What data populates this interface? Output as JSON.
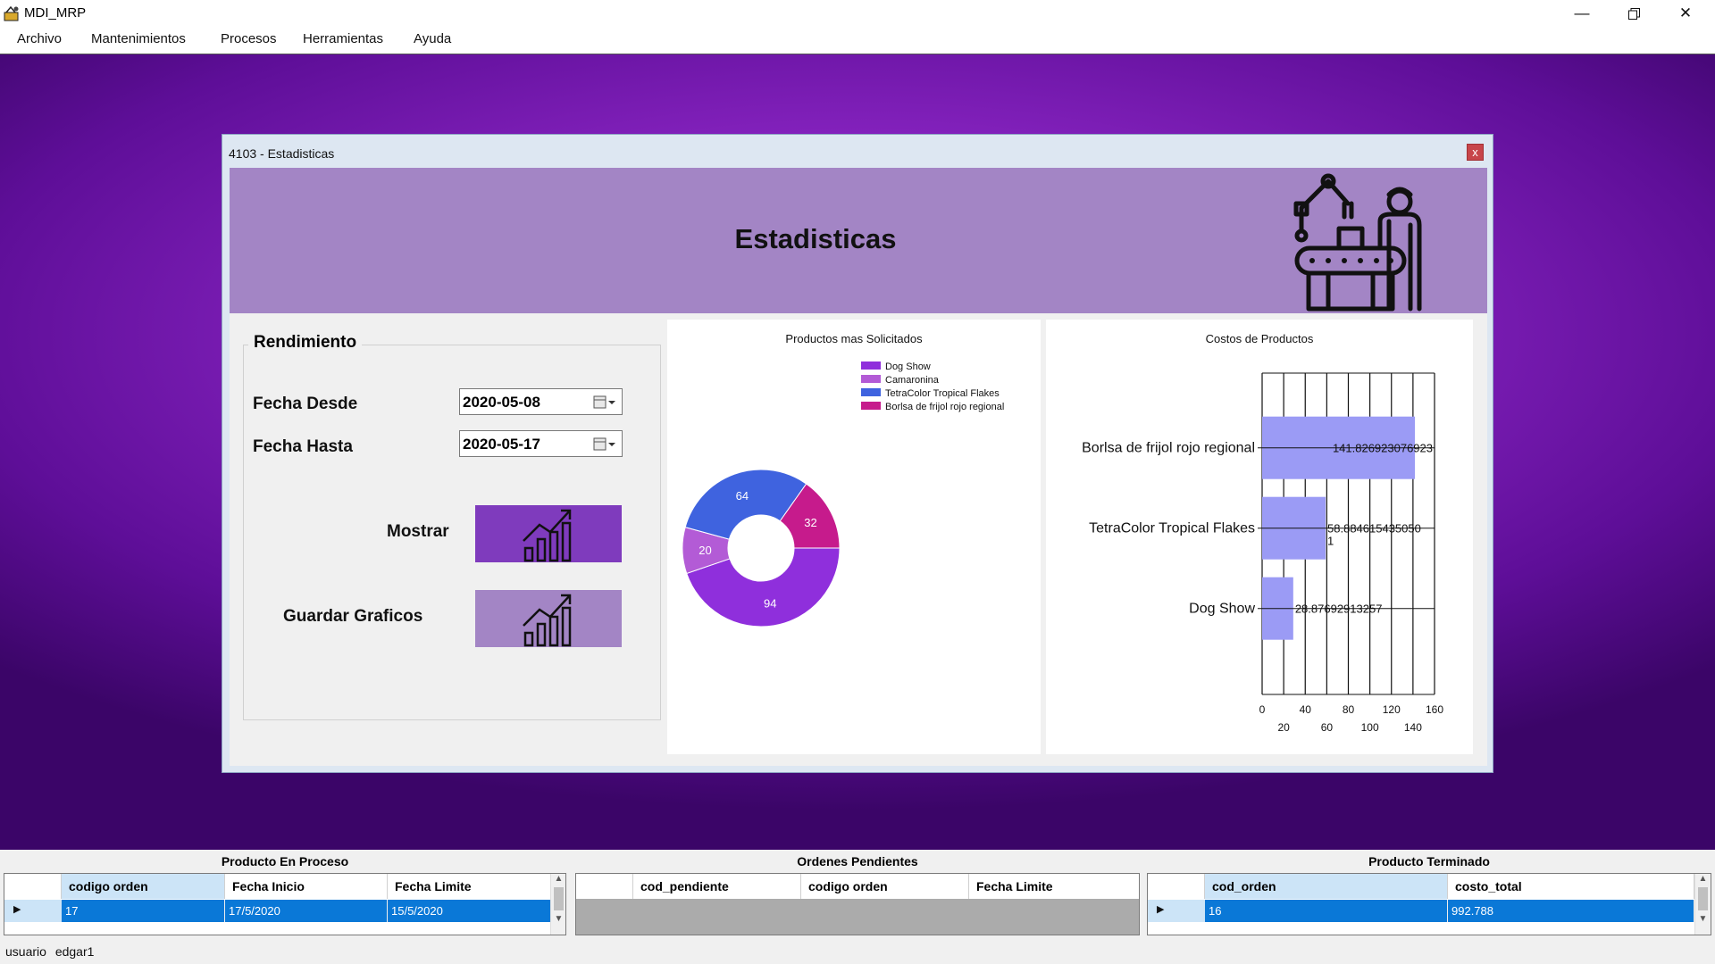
{
  "app": {
    "title": "MDI_MRP"
  },
  "menu": [
    "Archivo",
    "Mantenimientos",
    "Procesos",
    "Herramientas",
    "Ayuda"
  ],
  "child": {
    "title": "4103 - Estadisticas",
    "close_label": "x",
    "header_title": "Estadisticas"
  },
  "form": {
    "group_label": "Rendimiento",
    "from_label": "Fecha Desde",
    "from_value": "2020-05-08",
    "to_label": "Fecha Hasta",
    "to_value": "2020-05-17",
    "show_label": "Mostrar",
    "save_label": "Guardar Graficos",
    "show_button_color": "#7f3bbd",
    "save_button_color": "#a385c5"
  },
  "chart_data": [
    {
      "type": "pie",
      "title": "Productos mas Solicitados",
      "categories": [
        "Dog Show",
        "Camaronina",
        "TetraColor Tropical Flakes",
        "Borlsa de frijol rojo regional"
      ],
      "values": [
        94,
        20,
        64,
        32
      ],
      "colors": [
        "#8f2fdc",
        "#b35bd6",
        "#3f63df",
        "#c61b8c"
      ],
      "legend": "top-right"
    },
    {
      "type": "bar",
      "title": "Costos de Productos",
      "categories": [
        "Borlsa de frijol rojo regional",
        "TetraColor Tropical Flakes",
        "Dog Show"
      ],
      "values": [
        141.826923076923,
        58.8846153850501,
        28.876923913257
      ],
      "value_labels": [
        "141.826923076923",
        "58.884615435050\n1",
        "28.87692913257"
      ],
      "xlim": [
        0,
        160
      ],
      "xticks_top": [
        "0",
        "40",
        "80",
        "120",
        "160"
      ],
      "xticks_bottom": [
        "20",
        "60",
        "100",
        "140"
      ],
      "bar_color": "#9b9bf5",
      "grid": true
    }
  ],
  "grids": {
    "proceso": {
      "title": "Producto En Proceso",
      "columns": [
        "codigo orden",
        "Fecha Inicio",
        "Fecha Limite"
      ],
      "rows": [
        [
          "17",
          "17/5/2020",
          "15/5/2020"
        ]
      ]
    },
    "pendientes": {
      "title": "Ordenes Pendientes",
      "columns": [
        "cod_pendiente",
        "codigo orden",
        "Fecha Limite"
      ],
      "rows": []
    },
    "terminado": {
      "title": "Producto Terminado",
      "columns": [
        "cod_orden",
        "costo_total"
      ],
      "rows": [
        [
          "16",
          "992.788"
        ]
      ]
    }
  },
  "status": {
    "label": "usuario",
    "user": "edgar1"
  },
  "colors": {
    "selected_row": "#0a78d7",
    "header_title_bg": "#a385c5"
  }
}
